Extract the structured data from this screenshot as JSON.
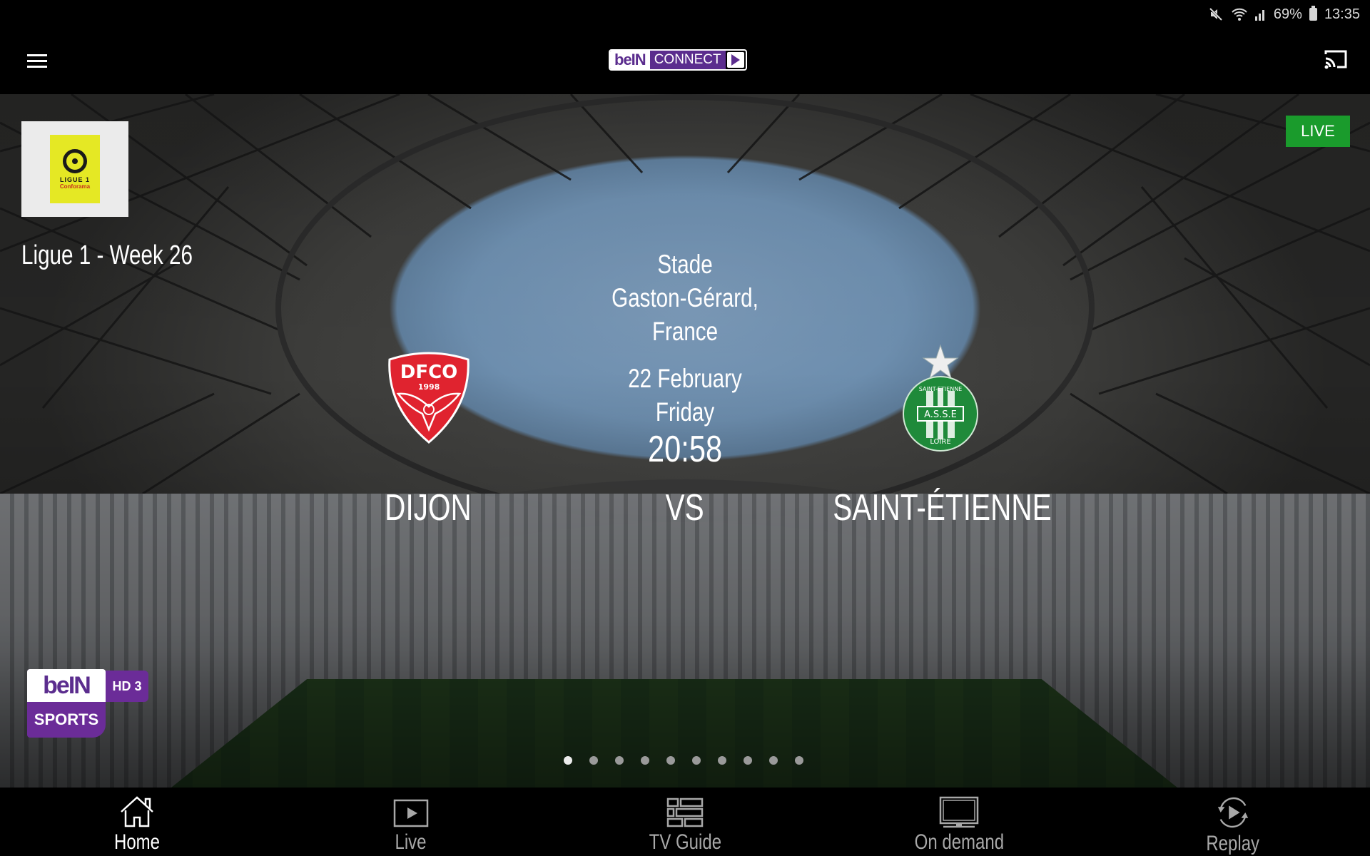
{
  "status_bar": {
    "icons": [
      "mute-icon",
      "wifi-icon",
      "signal-icon",
      "battery-icon"
    ],
    "battery": "69%",
    "time": "13:35"
  },
  "app_bar": {
    "menu_icon": "hamburger-menu-icon",
    "logo": {
      "brand": "beIN",
      "product": "CONNECT",
      "icon": "play-icon"
    },
    "cast_icon": "cast-icon",
    "brand_color": "#5b2d8e"
  },
  "hero": {
    "competition": {
      "logo": {
        "line1": "LIGUE 1",
        "line2": "Conforama"
      },
      "title": "Ligue 1 - Week 26"
    },
    "live_badge": "LIVE",
    "live_color": "#1a9b2c",
    "venue_lines": [
      "Stade",
      "Gaston-Gérard,",
      "France"
    ],
    "date_lines": [
      "22 February",
      "Friday"
    ],
    "time": "20:58",
    "home_team": {
      "name": "DIJON",
      "crest_text": "DFCO",
      "crest_year": "1998",
      "color": "#e0232f"
    },
    "vs_label": "VS",
    "away_team": {
      "name": "SAINT-ÉTIENNE",
      "crest_top": "SAINT-ETIENNE",
      "crest_mid": "A.S.S.E",
      "crest_bottom": "LOIRE",
      "color": "#1f8a3a"
    },
    "channel": {
      "brand": "beIN",
      "sub": "SPORTS",
      "tag": "HD 3"
    },
    "pager": {
      "total": 10,
      "active_index": 0
    }
  },
  "bottom_nav": {
    "items": [
      {
        "label": "Home",
        "icon": "home-icon",
        "active": true
      },
      {
        "label": "Live",
        "icon": "live-play-icon",
        "active": false
      },
      {
        "label": "TV Guide",
        "icon": "tv-guide-icon",
        "active": false
      },
      {
        "label": "On demand",
        "icon": "tv-icon",
        "active": false
      },
      {
        "label": "Replay",
        "icon": "replay-icon",
        "active": false
      }
    ]
  }
}
